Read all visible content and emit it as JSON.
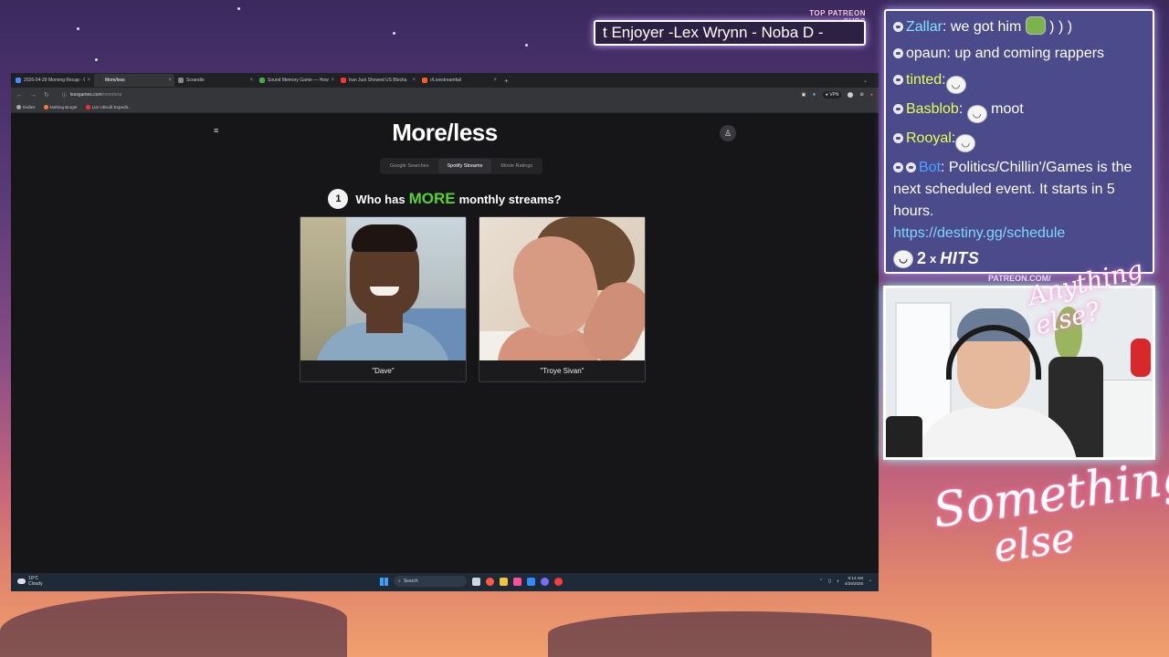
{
  "overlay": {
    "patreon_label": "TOP PATREON SUBS",
    "patreon_ticker": "t Enjoyer -Lex Wrynn -  Noba D -",
    "cam_label": "PATREON.COM/",
    "signature_top": "Anything else?",
    "signature_big_1": "Something",
    "signature_big_2": "else"
  },
  "browser": {
    "tabs": [
      {
        "label": "2026-04-29 Morning Recap - G",
        "color": "#4a8cff",
        "active": false
      },
      {
        "label": "More/less",
        "color": "#333333",
        "active": true
      },
      {
        "label": "Scrandle",
        "color": "#888888",
        "active": false
      },
      {
        "label": "Sound Memory Game — How",
        "color": "#4aa84a",
        "active": false
      },
      {
        "label": "Iran Just Showed US Blocka",
        "color": "#ff3030",
        "active": false
      },
      {
        "label": "r/Livestreamfail",
        "color": "#ff5a1f",
        "active": false
      }
    ],
    "url_host": "lessgames.com",
    "url_path": "/moreless",
    "vpn_label": "VPN",
    "bookmarks": [
      {
        "label": "Dailies",
        "color": "#aaaaaa"
      },
      {
        "label": "Nothing Burger",
        "color": "#ff7a33"
      },
      {
        "label": "Liar Ubisoft Expedit...",
        "color": "#ff2f2f"
      }
    ]
  },
  "site": {
    "title": "More/less",
    "categories": [
      {
        "label": "Google Searches",
        "active": false
      },
      {
        "label": "Spotify Streams",
        "active": true
      },
      {
        "label": "Movie Ratings",
        "active": false
      }
    ],
    "question_number": "1",
    "question_prefix": "Who has",
    "question_keyword": "MORE",
    "question_suffix": "monthly streams?",
    "option_a": "\"Dave\"",
    "option_b": "\"Troye Sivan\""
  },
  "taskbar": {
    "temp": "10°C",
    "condition": "Cloudy",
    "search_placeholder": "Search",
    "time": "8:14 AM",
    "date": "4/29/2026"
  },
  "chat": {
    "messages": [
      {
        "user": "Zallar",
        "user_color": "#7fe0ff",
        "text": " we got him ",
        "emote": "green",
        "after": " ) ) )"
      },
      {
        "user": "opaun",
        "user_color": "#ffffff",
        "text": " up and coming rappers"
      },
      {
        "user": "tinted",
        "user_color": "#e6ff4d",
        "text": "",
        "emote": "face"
      },
      {
        "user": "Basblob",
        "user_color": "#e6ff4d",
        "text": " ",
        "emote": "face",
        "after": " moot"
      },
      {
        "user": "Rooyal",
        "user_color": "#e6ff4d",
        "text": "",
        "emote": "face"
      }
    ],
    "bot_user": "Bot",
    "bot_text": ": Politics/Chillin'/Games is the next scheduled event. It starts in 5 hours.",
    "bot_link": "https://destiny.gg/schedule",
    "hits_count": "2",
    "hits_x": "x",
    "hits_word": "HITS"
  }
}
